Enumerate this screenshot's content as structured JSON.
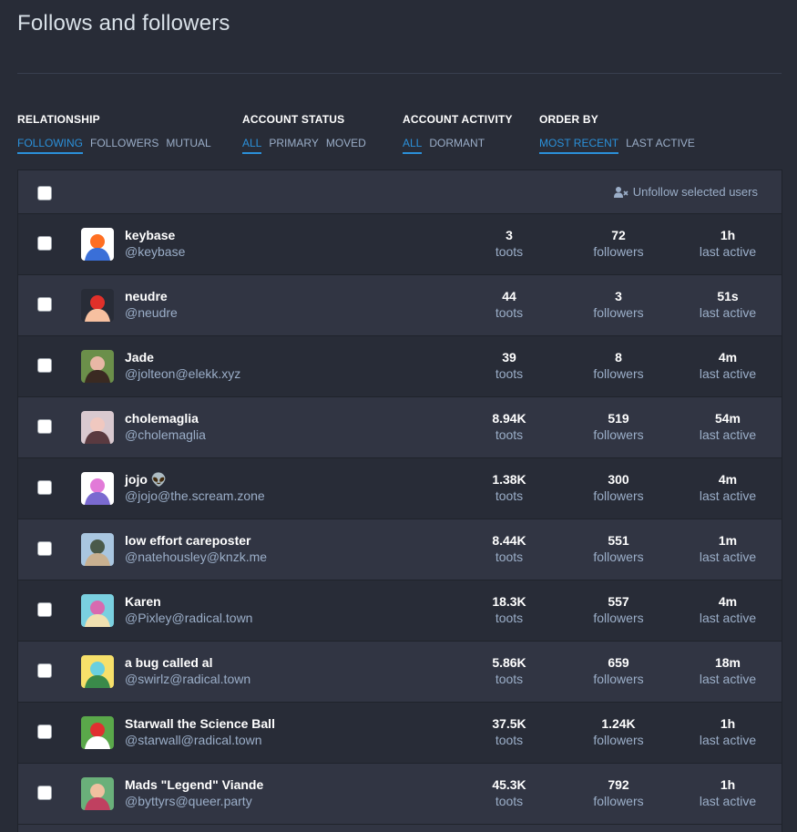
{
  "page": {
    "title": "Follows and followers"
  },
  "filters": [
    {
      "title": "RELATIONSHIP",
      "options": [
        "FOLLOWING",
        "FOLLOWERS",
        "MUTUAL"
      ],
      "selected": 0
    },
    {
      "title": "ACCOUNT STATUS",
      "options": [
        "ALL",
        "PRIMARY",
        "MOVED"
      ],
      "selected": 0
    },
    {
      "title": "ACCOUNT ACTIVITY",
      "options": [
        "ALL",
        "DORMANT"
      ],
      "selected": 0
    },
    {
      "title": "ORDER BY",
      "options": [
        "MOST RECENT",
        "LAST ACTIVE"
      ],
      "selected": 0
    }
  ],
  "table": {
    "unfollow_label": "Unfollow selected users",
    "rows": [
      {
        "name": "keybase",
        "acct": "@keybase",
        "toots": "3",
        "toots_label": "toots",
        "followers": "72",
        "followers_label": "followers",
        "active": "1h",
        "active_label": "last active",
        "avatar_colors": [
          "#ffffff",
          "#ff6f22",
          "#3a6fd8"
        ]
      },
      {
        "name": "neudre",
        "acct": "@neudre",
        "toots": "44",
        "toots_label": "toots",
        "followers": "3",
        "followers_label": "followers",
        "active": "51s",
        "active_label": "last active",
        "avatar_colors": [
          "#282c37",
          "#e0302a",
          "#f7c0a0"
        ]
      },
      {
        "name": "Jade",
        "acct": "@jolteon@elekk.xyz",
        "toots": "39",
        "toots_label": "toots",
        "followers": "8",
        "followers_label": "followers",
        "active": "4m",
        "active_label": "last active",
        "avatar_colors": [
          "#6b8f4a",
          "#e8b7a5",
          "#3a2a22"
        ]
      },
      {
        "name": "cholemaglia",
        "acct": "@cholemaglia",
        "toots": "8.94K",
        "toots_label": "toots",
        "followers": "519",
        "followers_label": "followers",
        "active": "54m",
        "active_label": "last active",
        "avatar_colors": [
          "#d9c9d0",
          "#f0c8c0",
          "#5a3a40"
        ]
      },
      {
        "name": "jojo 👽",
        "acct": "@jojo@the.scream.zone",
        "toots": "1.38K",
        "toots_label": "toots",
        "followers": "300",
        "followers_label": "followers",
        "active": "4m",
        "active_label": "last active",
        "avatar_colors": [
          "#ffffff",
          "#e27ad8",
          "#7a6ad0"
        ]
      },
      {
        "name": "low effort careposter",
        "acct": "@natehousley@knzk.me",
        "toots": "8.44K",
        "toots_label": "toots",
        "followers": "551",
        "followers_label": "followers",
        "active": "1m",
        "active_label": "last active",
        "avatar_colors": [
          "#a9c6e0",
          "#4a5a4a",
          "#c8b090"
        ]
      },
      {
        "name": "Karen",
        "acct": "@Pixley@radical.town",
        "toots": "18.3K",
        "toots_label": "toots",
        "followers": "557",
        "followers_label": "followers",
        "active": "4m",
        "active_label": "last active",
        "avatar_colors": [
          "#7ad0e0",
          "#d86ab0",
          "#f0e0b0"
        ]
      },
      {
        "name": "a bug called al",
        "acct": "@swirlz@radical.town",
        "toots": "5.86K",
        "toots_label": "toots",
        "followers": "659",
        "followers_label": "followers",
        "active": "18m",
        "active_label": "last active",
        "avatar_colors": [
          "#f7e06a",
          "#6ad0e0",
          "#3a8a4a"
        ]
      },
      {
        "name": "Starwall the Science Ball",
        "acct": "@starwall@radical.town",
        "toots": "37.5K",
        "toots_label": "toots",
        "followers": "1.24K",
        "followers_label": "followers",
        "active": "1h",
        "active_label": "last active",
        "avatar_colors": [
          "#5aa84a",
          "#e03030",
          "#ffffff"
        ]
      },
      {
        "name": "Mads \"Legend\" Viande",
        "acct": "@byttyrs@queer.party",
        "toots": "45.3K",
        "toots_label": "toots",
        "followers": "792",
        "followers_label": "followers",
        "active": "1h",
        "active_label": "last active",
        "avatar_colors": [
          "#6ab07a",
          "#f0c0a0",
          "#c04060"
        ]
      }
    ]
  },
  "colors": {
    "background": "#282c37",
    "row_alt": "#313543",
    "accent": "#2b90d9",
    "muted_text": "#9baec8"
  }
}
